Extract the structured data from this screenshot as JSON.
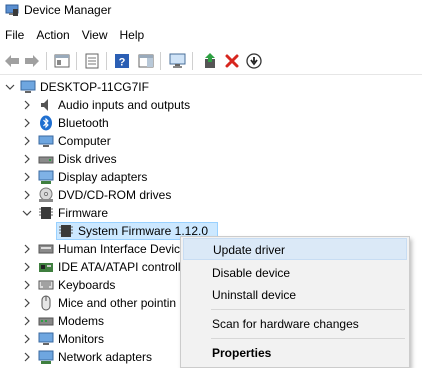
{
  "window": {
    "title": "Device Manager"
  },
  "menu": [
    "File",
    "Action",
    "View",
    "Help"
  ],
  "toolbar": {
    "buttons": [
      "back-icon",
      "forward-icon",
      "properties-pane-icon",
      "list-view-icon",
      "help-icon",
      "action-pane-icon",
      "monitor-scan-icon",
      "update-driver-icon",
      "uninstall-icon",
      "disable-icon"
    ]
  },
  "tree": {
    "root": "DESKTOP-11CG7IF",
    "items": [
      {
        "label": "Audio inputs and outputs",
        "icon": "speaker-icon"
      },
      {
        "label": "Bluetooth",
        "icon": "bluetooth-icon"
      },
      {
        "label": "Computer",
        "icon": "computer-icon"
      },
      {
        "label": "Disk drives",
        "icon": "disk-drive-icon"
      },
      {
        "label": "Display adapters",
        "icon": "display-adapter-icon"
      },
      {
        "label": "DVD/CD-ROM drives",
        "icon": "dvd-drive-icon"
      },
      {
        "label": "Firmware",
        "icon": "firmware-icon",
        "expanded": true
      },
      {
        "label": "System Firmware 1.12.0",
        "icon": "chip-icon",
        "child": true,
        "selected": true
      },
      {
        "label": "Human Interface Devic",
        "icon": "hid-icon"
      },
      {
        "label": "IDE ATA/ATAPI controll",
        "icon": "ide-controller-icon"
      },
      {
        "label": "Keyboards",
        "icon": "keyboard-icon"
      },
      {
        "label": "Mice and other pointin",
        "icon": "mouse-icon"
      },
      {
        "label": "Modems",
        "icon": "modem-icon"
      },
      {
        "label": "Monitors",
        "icon": "monitor-icon"
      },
      {
        "label": "Network adapters",
        "icon": "network-icon"
      }
    ]
  },
  "context_menu": {
    "items": [
      "Update driver",
      "Disable device",
      "Uninstall device",
      "Scan for hardware changes",
      "Properties"
    ],
    "highlighted": "Update driver"
  },
  "colors": {
    "selection": "#cce8ff",
    "menu_bg": "#f2f2f2",
    "menu_highlight": "#dbe9f7",
    "accent": "#0078d7",
    "delete_red": "#d7261e"
  }
}
